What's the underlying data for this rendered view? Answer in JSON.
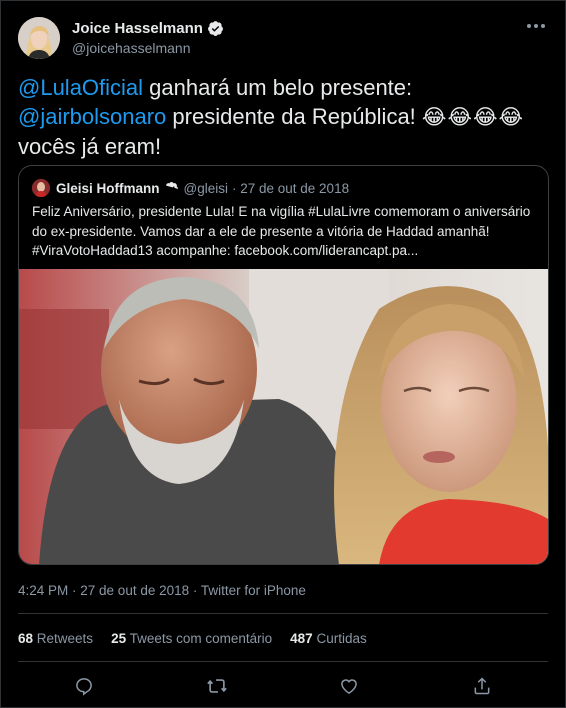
{
  "author": {
    "display_name": "Joice Hasselmann",
    "handle": "@joicehasselmann",
    "verified": true
  },
  "tweet": {
    "mention1": "@LulaOficial",
    "text1": " ganhará um belo presente:",
    "mention2": "@jairbolsonaro",
    "text2": " presidente da República! ",
    "emojis": "😂😂😂😂",
    "text3": "vocês já eram!"
  },
  "quoted": {
    "display_name": "Gleisi Hoffmann",
    "handle": "@gleisi",
    "date": "· 27 de out de 2018",
    "text": "Feliz Aniversário, presidente Lula! E na vigília #LulaLivre comemoram o aniversário do ex-presidente. Vamos dar a ele de presente a vitória de Haddad amanhã! #ViraVotoHaddad13 acompanhe: facebook.com/liderancapt.pa..."
  },
  "meta": {
    "timestamp": "4:24 PM · 27 de out de 2018 · Twitter for iPhone"
  },
  "stats": {
    "retweets_count": "68",
    "retweets_label": " Retweets",
    "quotes_count": "25",
    "quotes_label": " Tweets com comentário",
    "likes_count": "487",
    "likes_label": " Curtidas"
  },
  "colors": {
    "background": "#000000",
    "accent": "#1d9bf0",
    "secondary_text": "#8b98a5"
  },
  "icons": [
    "verified-badge-icon",
    "more-icon",
    "reply-icon",
    "retweet-icon",
    "like-icon",
    "share-icon"
  ]
}
